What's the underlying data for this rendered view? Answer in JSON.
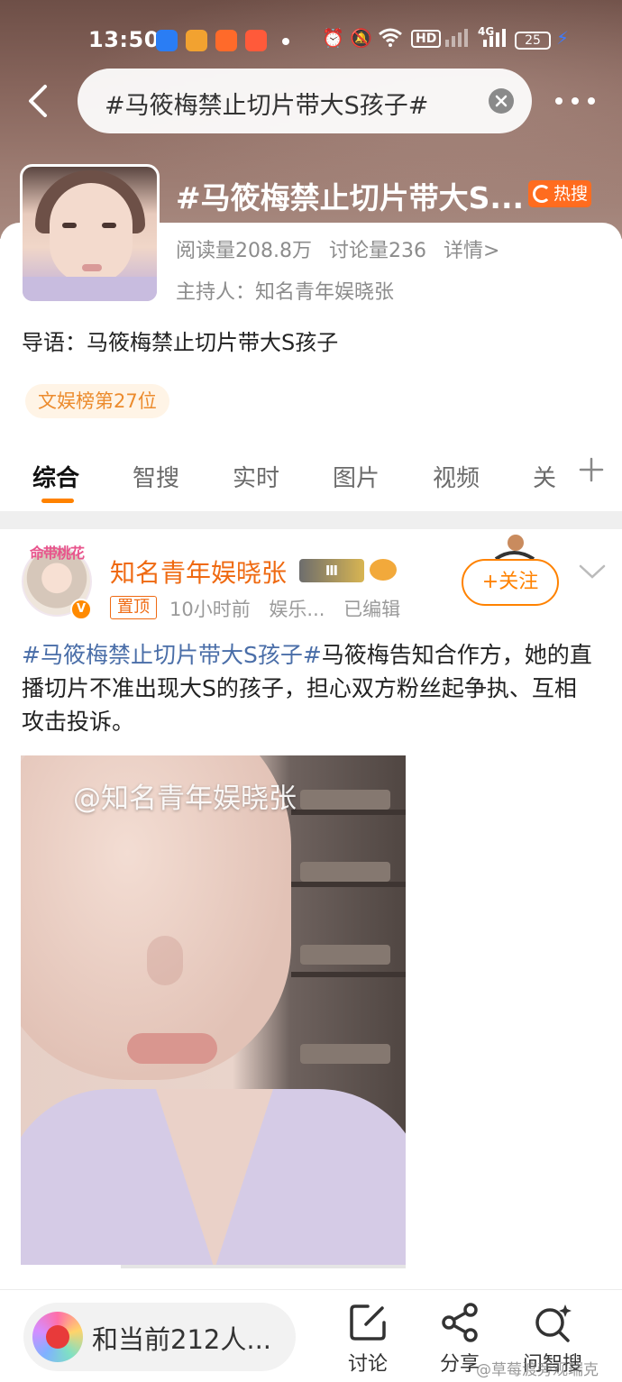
{
  "status_bar": {
    "time": "13:50",
    "network_label": "HD",
    "signal_label": "4G",
    "battery_level": "25"
  },
  "search": {
    "query": "#马筱梅禁止切片带大S孩子#"
  },
  "topic": {
    "title": "#马筱梅禁止切片带大S...",
    "hot_badge": "热搜",
    "reads": "阅读量208.8万",
    "discussions": "讨论量236",
    "details_link": "详情>",
    "host": "主持人：知名青年娱晓张",
    "guide": "导语：马筱梅禁止切片带大S孩子",
    "rank": "文娱榜第27位"
  },
  "tabs": [
    "综合",
    "智搜",
    "实时",
    "图片",
    "视频",
    "关"
  ],
  "post": {
    "avatar_caption": "命带桃花",
    "vip_mark": "V",
    "author": "知名青年娱晓张",
    "level_badge": "Ⅲ",
    "pin_tag": "置顶",
    "time": "10小时前",
    "source": "娱乐...",
    "edited": "已编辑",
    "follow_label": "+关注",
    "hashtag": "#马筱梅禁止切片带大S孩子#",
    "text": "马筱梅告知合作方，她的直播切片不准出现大S的孩子，担心双方粉丝起争执、互相攻击投诉。",
    "image_watermark": "@知名青年娱晓张",
    "video_progress": 0.26
  },
  "bottom_bar": {
    "chat_text": "和当前212人...",
    "actions": [
      "讨论",
      "分享",
      "问智搜"
    ],
    "corner_watermark": "@草莓渡旁观瑞克"
  },
  "colors": {
    "accent": "#ff8200",
    "author": "#ef6a12",
    "hashtag": "#4a6ea8",
    "hot": "#ff6c1f",
    "rank_text": "#ec8b2d"
  }
}
